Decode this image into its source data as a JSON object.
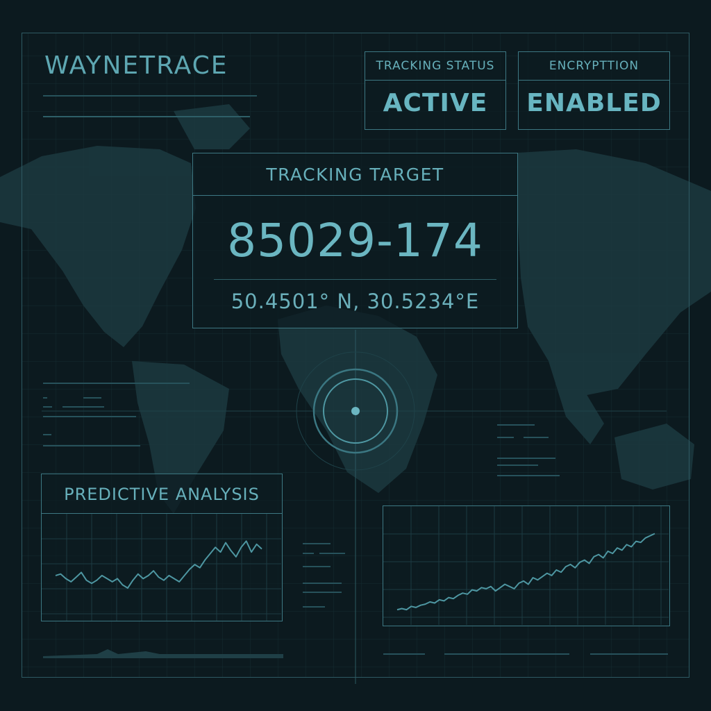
{
  "app": {
    "brand": "WAYNETRACE"
  },
  "status_cards": [
    {
      "label": "TRACKING STATUS",
      "value": "ACTIVE"
    },
    {
      "label": "ENCRYPTTION",
      "value": "ENABLED"
    }
  ],
  "target": {
    "label": "TRACKING TARGET",
    "id": "85029-174",
    "coordinates": "50.4501° N, 30.5234°E"
  },
  "panels": {
    "predictive": {
      "title": "PREDICTIVE ANALYSIS"
    }
  },
  "colors": {
    "background": "#0c1a1f",
    "accent": "#5ea7b2",
    "line": "#3d7883"
  },
  "chart_data": [
    {
      "type": "line",
      "title": "PREDICTIVE ANALYSIS",
      "x": [
        0,
        1,
        2,
        3,
        4,
        5,
        6,
        7,
        8,
        9,
        10,
        11,
        12,
        13,
        14,
        15,
        16,
        17,
        18,
        19,
        20,
        21,
        22,
        23,
        24,
        25,
        26,
        27,
        28,
        29,
        30,
        31,
        32,
        33,
        34,
        35,
        36,
        37,
        38,
        39,
        40
      ],
      "series": [
        {
          "values": [
            40,
            41,
            38,
            36,
            39,
            42,
            37,
            35,
            37,
            40,
            38,
            36,
            38,
            34,
            32,
            37,
            41,
            38,
            40,
            43,
            39,
            37,
            40,
            38,
            36,
            40,
            44,
            47,
            45,
            50,
            54,
            58,
            55,
            61,
            56,
            52,
            58,
            62,
            55,
            60,
            57
          ]
        }
      ],
      "ylim": [
        20,
        75
      ],
      "grid": true
    },
    {
      "type": "line",
      "x": [
        0,
        1,
        2,
        3,
        4,
        5,
        6,
        7,
        8,
        9,
        10,
        11,
        12,
        13,
        14,
        15,
        16,
        17,
        18,
        19,
        20,
        21,
        22,
        23,
        24,
        25,
        26,
        27,
        28,
        29,
        30,
        31,
        32,
        33,
        34,
        35,
        36,
        37,
        38,
        39,
        40,
        41,
        42,
        43,
        44,
        45,
        46,
        47,
        48,
        49,
        50,
        51,
        52,
        53,
        54,
        55
      ],
      "series": [
        {
          "values": [
            5,
            6,
            5,
            8,
            7,
            9,
            10,
            12,
            11,
            14,
            13,
            16,
            15,
            18,
            20,
            19,
            23,
            22,
            25,
            24,
            26,
            22,
            25,
            28,
            26,
            24,
            29,
            31,
            28,
            34,
            32,
            35,
            38,
            36,
            41,
            39,
            44,
            46,
            43,
            48,
            50,
            47,
            53,
            55,
            52,
            58,
            56,
            61,
            59,
            64,
            62,
            67,
            66,
            70,
            72,
            74
          ]
        }
      ],
      "ylim": [
        0,
        85
      ],
      "grid": true
    }
  ]
}
